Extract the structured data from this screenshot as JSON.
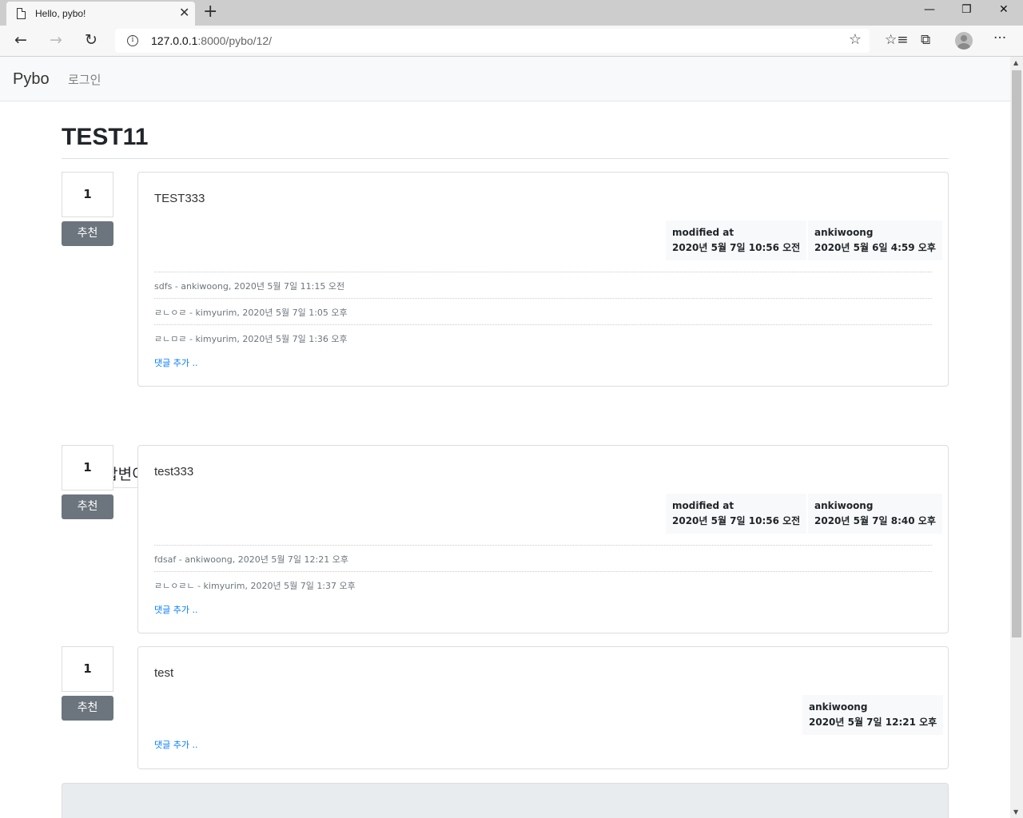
{
  "browser": {
    "tab_title": "Hello, pybo!",
    "tab_close": "✕",
    "new_tab": "+",
    "url_host": "127.0.0.1",
    "url_rest": ":8000/pybo/12/",
    "back": "←",
    "forward": "→",
    "reload": "↻",
    "minimize": "—",
    "restore": "❐",
    "close": "✕",
    "more": "···"
  },
  "navbar": {
    "brand": "Pybo",
    "login": "로그인"
  },
  "question": {
    "title": "TEST11",
    "votes": "1",
    "vote_label": "추천",
    "content": "TEST333",
    "modified_label": "modified at",
    "modified_date": "2020년 5월 7일 10:56 오전",
    "author": "ankiwoong",
    "created_date": "2020년 5월 6일 4:59 오후",
    "comments": [
      "sdfs - ankiwoong, 2020년 5월 7일 11:15 오전",
      "ㄹㄴㅇㄹ - kimyurim, 2020년 5월 7일 1:05 오후",
      "ㄹㄴㅁㄹ - kimyurim, 2020년 5월 7일 1:36 오후"
    ],
    "add_comment": "댓글 추가 .."
  },
  "answer_count_text": "2개의 답변이 있습니다.",
  "answers": [
    {
      "votes": "1",
      "vote_label": "추천",
      "content": "test333",
      "modified_label": "modified at",
      "modified_date": "2020년 5월 7일 10:56 오전",
      "author": "ankiwoong",
      "created_date": "2020년 5월 7일 8:40 오후",
      "comments": [
        "fdsaf - ankiwoong, 2020년 5월 7일 12:21 오후",
        "ㄹㄴㅇㄹㄴ - kimyurim, 2020년 5월 7일 1:37 오후"
      ],
      "add_comment": "댓글 추가 .."
    },
    {
      "votes": "1",
      "vote_label": "추천",
      "content": "test",
      "author": "ankiwoong",
      "created_date": "2020년 5월 7일 12:21 오후",
      "add_comment": "댓글 추가 .."
    }
  ]
}
